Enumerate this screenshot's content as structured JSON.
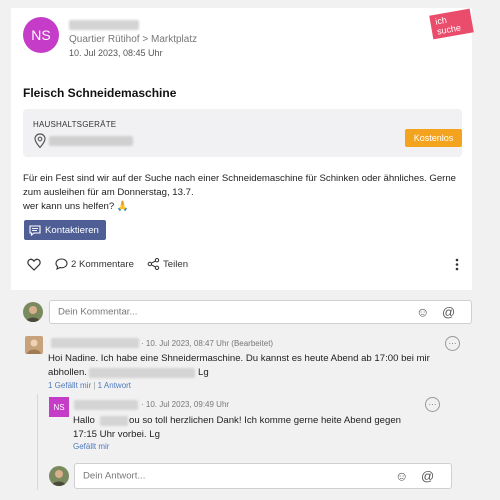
{
  "post": {
    "initials": "NS",
    "location": "Quartier Rütihof > Marktplatz",
    "date": "10. Jul 2023, 08:45 Uhr",
    "tag": "ich suche",
    "title": "Fleisch Schneidemaschine",
    "category": "HAUSHALTSGERÄTE",
    "price": "Kostenlos",
    "description": "Für ein Fest sind wir auf der Suche nach einer Schneidemaschine für Schinken oder ähnliches. Gerne zum ausleihen für am Donnerstag, 13.7.",
    "description2": "wer kann uns helfen? 🙏",
    "contact_button": "Kontaktieren",
    "comments_label": "2 Kommentare",
    "share_label": "Teilen"
  },
  "comment_input": {
    "placeholder": "Dein Kommentar..."
  },
  "comment1": {
    "meta": "· 10. Jul 2023, 08:47 Uhr  (Bearbeitet)",
    "text1": "Hoi Nadine. Ich habe eine Shneidermaschine.  Du kannst es heute Abend ab 17:00 bei mir",
    "text2a": "abhollen.",
    "text2b": "Lg",
    "likes": "1 Gefällt mir",
    "replies": "1 Antwort"
  },
  "reply1": {
    "initials": "NS",
    "meta": "· 10. Jul 2023, 09:49 Uhr",
    "text1a": "Hallo",
    "text1b": "ou so toll herzlichen Dank! Ich komme gerne heite Abend gegen",
    "text2": "17:15 Uhr vorbei. Lg",
    "likes": "Gefällt mir"
  },
  "reply_input": {
    "placeholder": "Dein Antwort..."
  },
  "colors": {
    "accent": "#4f5f96",
    "avatar": "#c53cc8",
    "price": "#f3a31d",
    "tag": "#ea4d6b",
    "link": "#4f7bbd"
  }
}
